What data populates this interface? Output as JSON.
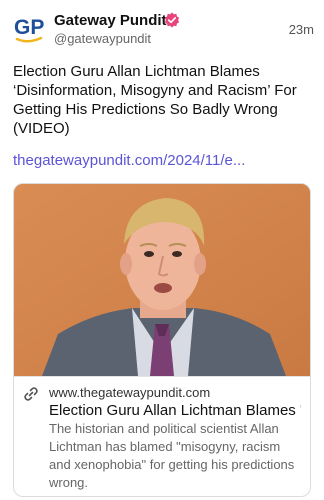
{
  "header": {
    "author_name": "Gateway Pundit",
    "handle": "@gatewaypundit",
    "timestamp": "23m",
    "logo_text": "GP",
    "verified_icon": "verified-badge-icon",
    "brand_color": "#1f4e9a",
    "logo_accent": "#f2b51d",
    "verified_color": "#e8457c"
  },
  "post": {
    "text": "Election Guru Allan Lichtman Blames ‘Disinformation, Misogyny and Racism’ For Getting His Predictions So Badly Wrong (VIDEO)",
    "link": "thegatewaypundit.com/2024/11/e...",
    "link_color": "#5b54d6"
  },
  "card": {
    "link_icon": "link-icon",
    "domain": "www.thegatewaypundit.com",
    "title": "Election Guru Allan Lichtman Blames '...",
    "description": "The historian and political scientist Allan Lichtman has blamed \"misogyny, racism and xenophobia\" for getting his predictions wrong."
  }
}
